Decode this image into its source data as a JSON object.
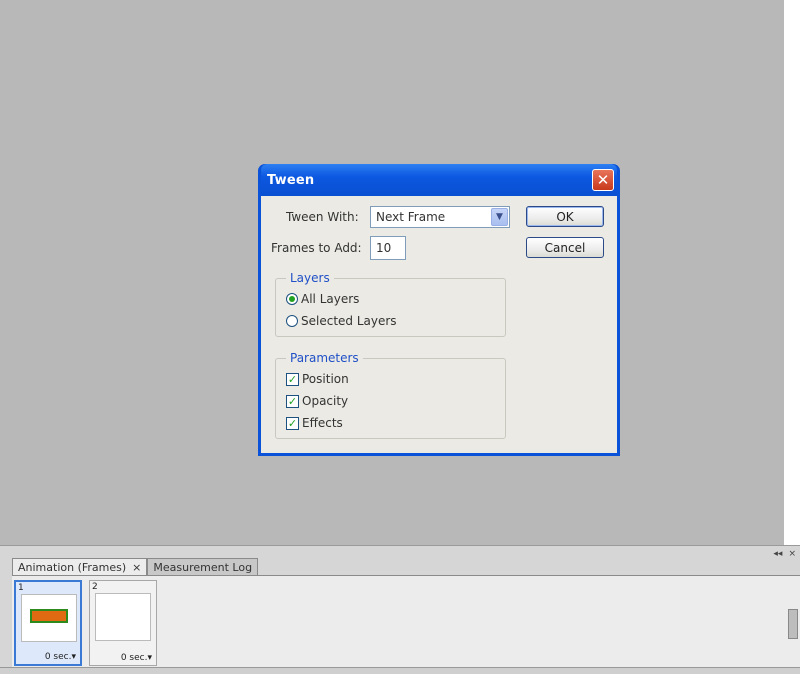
{
  "dialog": {
    "title": "Tween",
    "close_glyph": "✕",
    "tween_with_label": "Tween With:",
    "tween_with_value": "Next Frame",
    "frames_to_add_label": "Frames to Add:",
    "frames_to_add_value": "10",
    "ok_label": "OK",
    "cancel_label": "Cancel",
    "layers_group": {
      "legend": "Layers",
      "options": [
        "All Layers",
        "Selected Layers"
      ],
      "selected": "All Layers"
    },
    "parameters_group": {
      "legend": "Parameters",
      "options": [
        {
          "label": "Position",
          "checked": true
        },
        {
          "label": "Opacity",
          "checked": true
        },
        {
          "label": "Effects",
          "checked": true
        }
      ]
    }
  },
  "panel": {
    "tabs": [
      {
        "label": "Animation (Frames)",
        "active": true
      },
      {
        "label": "Measurement Log",
        "active": false
      }
    ],
    "tab_close": "×",
    "frames": [
      {
        "number": "1",
        "delay": "0 sec."
      },
      {
        "number": "2",
        "delay": "0 sec."
      }
    ]
  },
  "colors": {
    "canvas": "#b9b8b9",
    "title_bar": "#0c58e0",
    "dialog_bg": "#ebeae4",
    "group_legend": "#2050c8"
  }
}
